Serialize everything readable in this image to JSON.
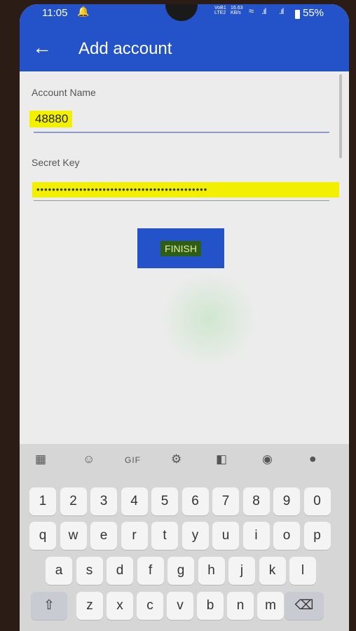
{
  "status": {
    "time": "11:05",
    "network": "VoB1 LTE2",
    "speed": "16.63 KB/s",
    "battery": "55%"
  },
  "appbar": {
    "title": "Add account"
  },
  "form": {
    "account_label": "Account Name",
    "account_value": "48880",
    "secret_label": "Secret Key",
    "secret_value": "••••••••••••••••••••••••••••••••••••••••••••",
    "finish_label": "FINISH"
  },
  "keyboard": {
    "toolbar": {
      "gif": "GIF"
    },
    "row_numbers": [
      "1",
      "2",
      "3",
      "4",
      "5",
      "6",
      "7",
      "8",
      "9",
      "0"
    ],
    "row_1": [
      "q",
      "w",
      "e",
      "r",
      "t",
      "y",
      "u",
      "i",
      "o",
      "p"
    ],
    "row_2": [
      "a",
      "s",
      "d",
      "f",
      "g",
      "h",
      "j",
      "k",
      "l"
    ],
    "row_3": [
      "z",
      "x",
      "c",
      "v",
      "b",
      "n",
      "m"
    ]
  },
  "colors": {
    "primary": "#2452c8",
    "highlight": "#f4f100",
    "finish_text_bg": "#2e5d16"
  },
  "icons": [
    "back-arrow-icon",
    "notification-icon",
    "wifi-icon",
    "signal-icon",
    "battery-icon",
    "apps-grid-icon",
    "sticker-icon",
    "settings-icon",
    "translate-icon",
    "palette-icon",
    "mic-icon",
    "shift-icon",
    "backspace-icon"
  ]
}
